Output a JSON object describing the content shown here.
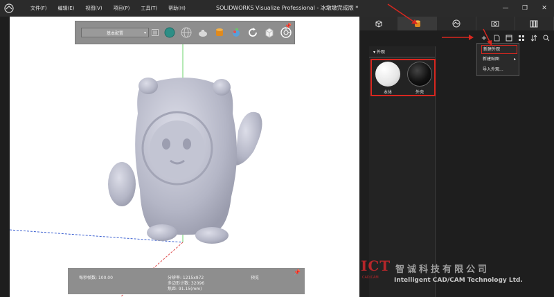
{
  "window": {
    "title": "SOLIDWORKS Visualize Professional - 冰墩墩完成版 *",
    "menus": [
      "文件(F)",
      "编辑(E)",
      "视图(V)",
      "项目(P)",
      "工具(T)",
      "帮助(H)"
    ],
    "controls": [
      "—",
      "❐",
      "✕"
    ]
  },
  "viewport_toolbar": {
    "preset": "基本配置",
    "icons": [
      "sphere-icon",
      "globe-icon",
      "teapot-icon",
      "paint-bucket-icon",
      "color-scene-icon",
      "cube-icon",
      "refresh-icon",
      "box-icon",
      "camera-aperture-icon"
    ]
  },
  "stats": {
    "fps": "每秒帧数: 100.00",
    "resolution": "分辨率: 1215x972",
    "polygons": "多边形计数: 32096",
    "focal": "焦距: 91.15(mm)",
    "mode": "预览"
  },
  "right_panel": {
    "tabs": [
      "cube-tab",
      "appearance-tab",
      "scene-tab",
      "camera-tab",
      "library-tab"
    ],
    "section_label": "▾ 外观",
    "materials": [
      {
        "name": "本体",
        "color": "#f4f4f4"
      },
      {
        "name": "外壳",
        "color": "#1a1a1a"
      }
    ],
    "context_menu": [
      {
        "label": "新建外观"
      },
      {
        "label": "新建贴图",
        "submenu": "▸"
      },
      {
        "label": "导入外观..."
      }
    ]
  },
  "watermark": {
    "logo": "ICT",
    "logo_sub": "CAD/CAM",
    "company_cn": "智诚科技有限公司",
    "company_en": "Intelligent CAD/CAM Technology Ltd."
  },
  "colors": {
    "accent_red": "#d9271f",
    "panel_bg": "#1e1e1e",
    "toolbar_gray": "#8e8e8e"
  }
}
